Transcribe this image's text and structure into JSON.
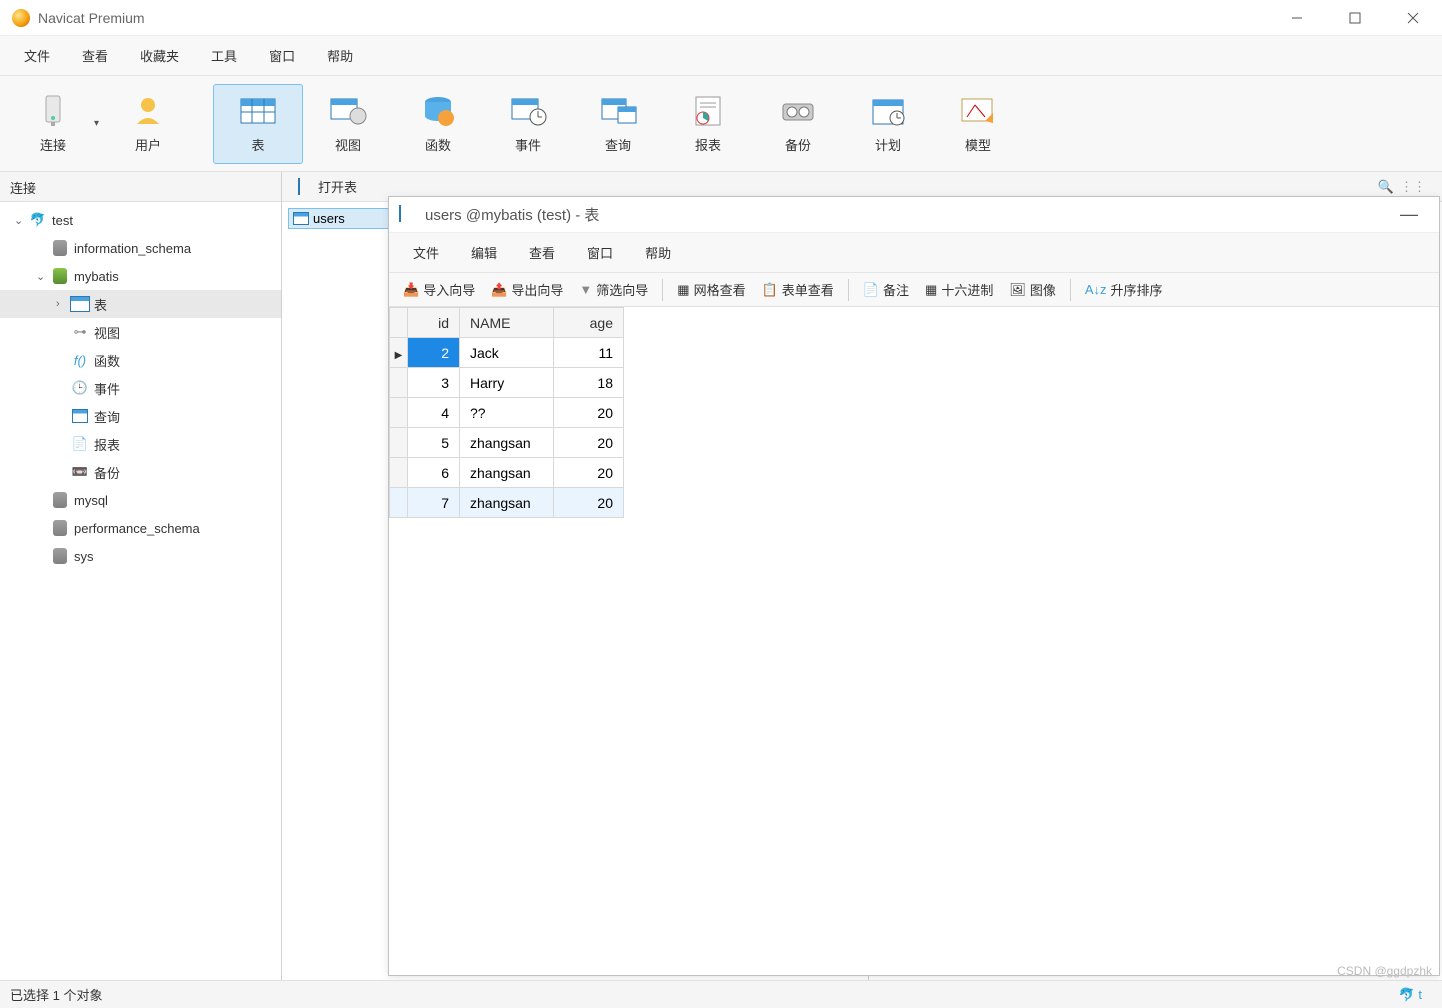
{
  "window": {
    "title": "Navicat Premium"
  },
  "menu": {
    "file": "文件",
    "view": "查看",
    "fav": "收藏夹",
    "tools": "工具",
    "window": "窗口",
    "help": "帮助"
  },
  "ribbon": {
    "connect": "连接",
    "user": "用户",
    "table": "表",
    "view": "视图",
    "function": "函数",
    "event": "事件",
    "query": "查询",
    "report": "报表",
    "backup": "备份",
    "schedule": "计划",
    "model": "模型"
  },
  "sidebar": {
    "header": "连接",
    "connection": "test",
    "databases": {
      "info_schema": "information_schema",
      "mybatis": "mybatis",
      "mysql": "mysql",
      "perf_schema": "performance_schema",
      "sys": "sys"
    },
    "objects": {
      "table": "表",
      "view": "视图",
      "function": "函数",
      "event": "事件",
      "query": "查询",
      "report": "报表",
      "backup": "备份"
    }
  },
  "main_toolbar": {
    "open": "打开表"
  },
  "object_list": {
    "users": "users"
  },
  "subwindow": {
    "title": "users @mybatis (test) - 表",
    "menu": {
      "file": "文件",
      "edit": "编辑",
      "view": "查看",
      "window": "窗口",
      "help": "帮助"
    },
    "tools": {
      "import": "导入向导",
      "export": "导出向导",
      "filter": "筛选向导",
      "grid": "网格查看",
      "form": "表单查看",
      "note": "备注",
      "hex": "十六进制",
      "image": "图像",
      "sort": "升序排序"
    },
    "columns": {
      "id": "id",
      "name": "NAME",
      "age": "age"
    },
    "rows": [
      {
        "id": "2",
        "name": "Jack",
        "age": "11"
      },
      {
        "id": "3",
        "name": "Harry",
        "age": "18"
      },
      {
        "id": "4",
        "name": "??",
        "age": "20"
      },
      {
        "id": "5",
        "name": "zhangsan",
        "age": "20"
      },
      {
        "id": "6",
        "name": "zhangsan",
        "age": "20"
      },
      {
        "id": "7",
        "name": "zhangsan",
        "age": "20"
      }
    ]
  },
  "status": {
    "text": "已选择 1 个对象",
    "conn": "t"
  },
  "watermark": "CSDN @ggdpzhk"
}
